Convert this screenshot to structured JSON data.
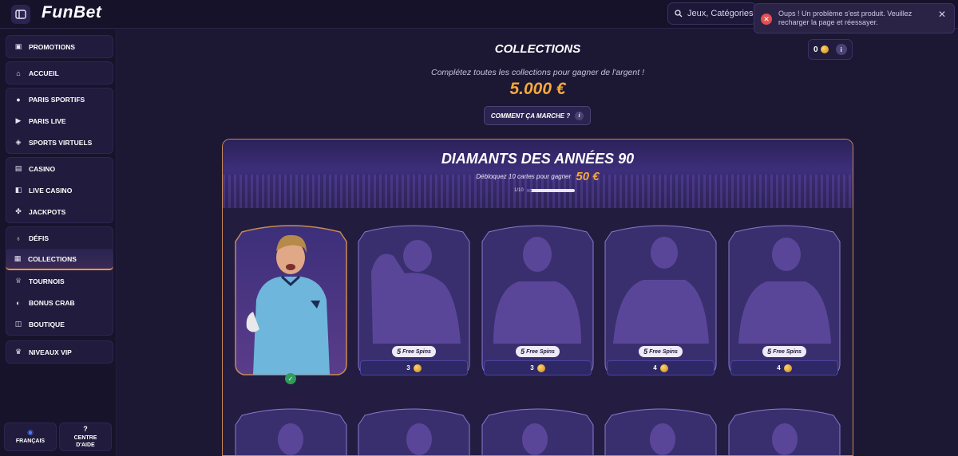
{
  "header": {
    "logo": "FunBet",
    "search_placeholder": "Jeux, Catégories",
    "menu_icon": "sidebar-toggle-icon"
  },
  "toast": {
    "message": "Oups ! Un problème s'est produit. Veuillez recharger la page et réessayer.",
    "close_label": "✕",
    "icon": "error-icon"
  },
  "sidebar": {
    "groups": [
      [
        {
          "label": "PROMOTIONS",
          "icon": "gift-icon"
        }
      ],
      [
        {
          "label": "ACCUEIL",
          "icon": "home-icon"
        }
      ],
      [
        {
          "label": "PARIS SPORTIFS",
          "icon": "soccer-ball-icon"
        },
        {
          "label": "PARIS LIVE",
          "icon": "live-icon"
        },
        {
          "label": "SPORTS VIRTUELS",
          "icon": "gamepad-icon"
        }
      ],
      [
        {
          "label": "CASINO",
          "icon": "slot-machine-icon"
        },
        {
          "label": "LIVE CASINO",
          "icon": "cards-icon"
        },
        {
          "label": "JACKPOTS",
          "icon": "clover-icon"
        }
      ],
      [
        {
          "label": "DÉFIS",
          "icon": "medal-icon"
        },
        {
          "label": "COLLECTIONS",
          "icon": "album-icon"
        },
        {
          "label": "TOURNOIS",
          "icon": "trophy-icon"
        },
        {
          "label": "BONUS CRAB",
          "icon": "crab-icon"
        },
        {
          "label": "BOUTIQUE",
          "icon": "shop-icon"
        }
      ],
      [
        {
          "label": "NIVEAUX VIP",
          "icon": "crown-icon"
        }
      ]
    ],
    "active": "COLLECTIONS",
    "language_label": "FRANÇAIS",
    "help_label_line1": "CENTRE",
    "help_label_line2": "D'AIDE"
  },
  "main": {
    "title": "COLLECTIONS",
    "coin_balance": "0",
    "subtitle": "Complétez toutes les collections pour gagner de l'argent !",
    "prize": "5.000 €",
    "how_button": "COMMENT ÇA MARCHE ?",
    "collection": {
      "title": "DIAMANTS DES ANNÉES 90",
      "subtitle": "Débloquez 10 cartes pour gagner",
      "reward": "50 €",
      "progress_text": "1/10",
      "progress_fraction": 0.1
    },
    "cards": [
      {
        "state": "unlocked",
        "player": "goalkeeper",
        "check": "✓"
      },
      {
        "state": "locked",
        "free_spins_count": "5",
        "free_spins_label": "Free Spins",
        "cost": "3"
      },
      {
        "state": "locked",
        "free_spins_count": "5",
        "free_spins_label": "Free Spins",
        "cost": "3"
      },
      {
        "state": "locked",
        "free_spins_count": "5",
        "free_spins_label": "Free Spins",
        "cost": "4"
      },
      {
        "state": "locked",
        "free_spins_count": "5",
        "free_spins_label": "Free Spins",
        "cost": "4"
      }
    ]
  },
  "colors": {
    "accent": "#f6a93b",
    "frame": "#c98a55",
    "background": "#1c1733",
    "success": "#2f9e59",
    "error": "#e05252"
  }
}
